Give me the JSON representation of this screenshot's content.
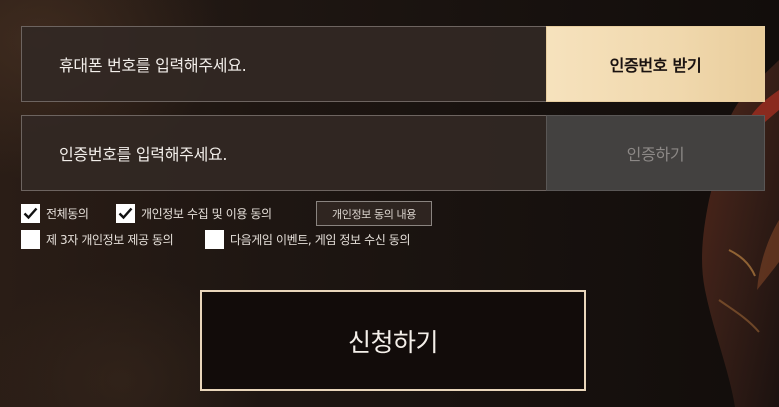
{
  "phone_row": {
    "placeholder": "휴대폰 번호를 입력해주세요.",
    "button_label": "인증번호 받기"
  },
  "code_row": {
    "placeholder": "인증번호를 입력해주세요.",
    "button_label": "인증하기"
  },
  "agreements": {
    "all": {
      "label": "전체동의",
      "checked": true
    },
    "privacy": {
      "label": "개인정보 수집 및 이용 동의",
      "checked": true
    },
    "detail_button": "개인정보 동의 내용",
    "third_party": {
      "label": "제 3자 개인정보 제공 동의",
      "checked": false
    },
    "marketing": {
      "label": "다음게임 이벤트, 게임 정보 수신 동의",
      "checked": false
    }
  },
  "submit_label": "신청하기",
  "colors": {
    "accent_gold": "#f0d8ad",
    "disabled_gray": "#434140",
    "submit_border": "#e9d6bb"
  }
}
